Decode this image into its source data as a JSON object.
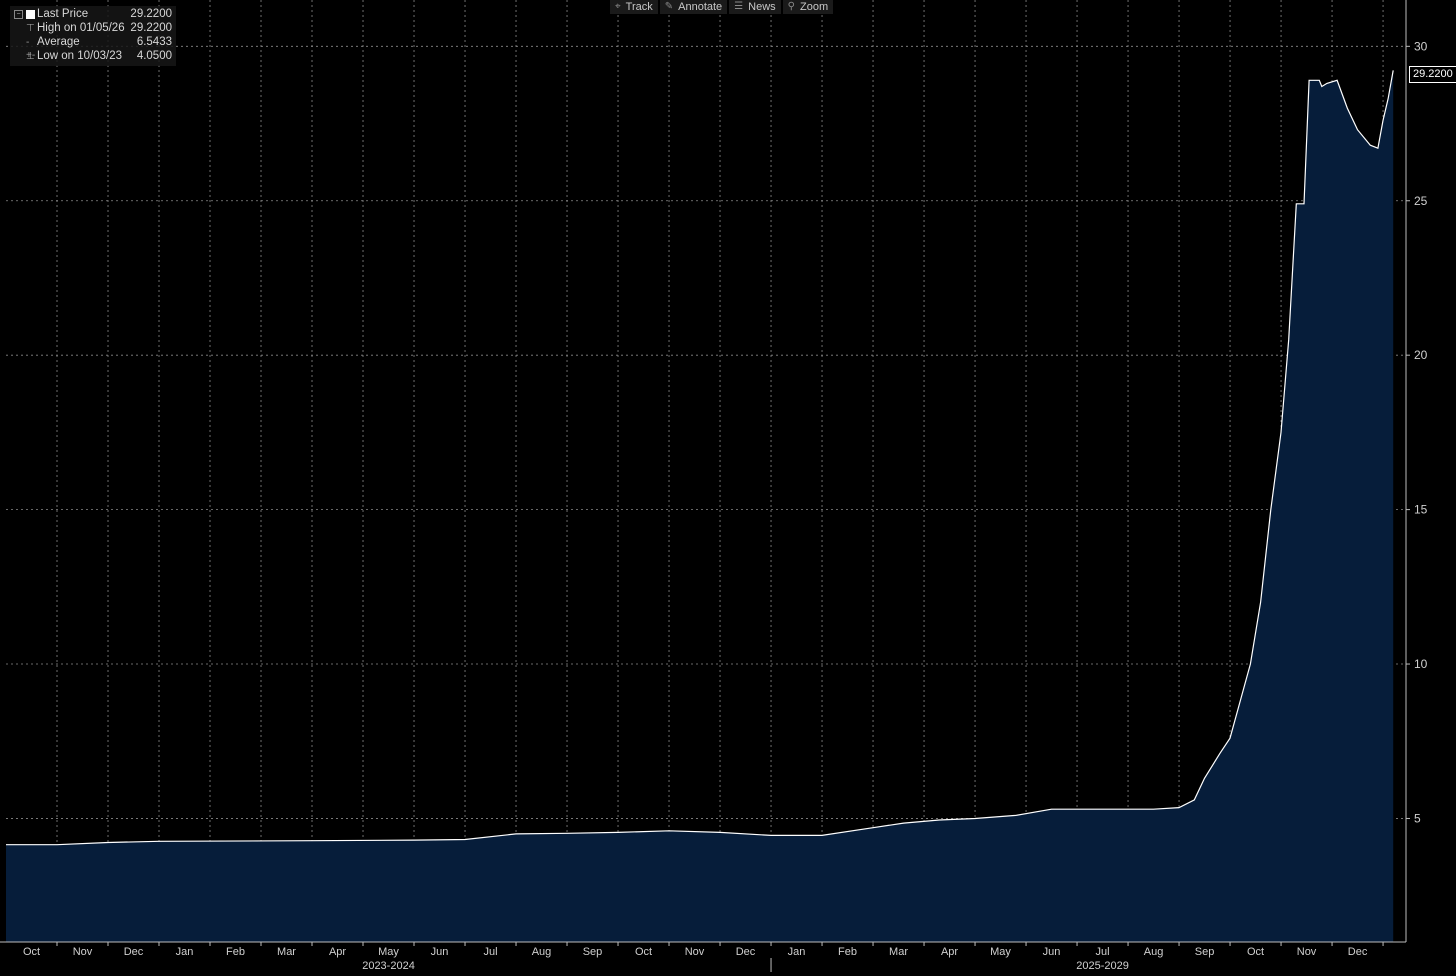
{
  "toolbar": {
    "items": [
      {
        "label": "Track",
        "icon": "crosshair-icon"
      },
      {
        "label": "Annotate",
        "icon": "pencil-icon"
      },
      {
        "label": "News",
        "icon": "news-icon"
      },
      {
        "label": "Zoom",
        "icon": "magnifier-icon"
      }
    ]
  },
  "legend": {
    "last_label": "Last Price",
    "last_value": "29.2200",
    "high_label": "High on 01/05/26",
    "high_value": "29.2200",
    "avg_label": "Average",
    "avg_value": "6.5433",
    "low_label": "Low on 10/03/23",
    "low_value": "4.0500"
  },
  "colors": {
    "background": "#000000",
    "line": "#ffffff",
    "area": "#061d3a",
    "grid": "#8a8a8a"
  },
  "chart_data": {
    "type": "area",
    "title": "",
    "xlabel": "",
    "ylabel": "",
    "ylim": [
      1.0,
      31.5
    ],
    "last_value_badge": "29.2200",
    "yticks": [
      5,
      10,
      15,
      20,
      25,
      30
    ],
    "ytick_labels": [
      "5",
      "10",
      "15",
      "20",
      "25",
      "30"
    ],
    "xticks": [
      {
        "label": "Oct",
        "t": 0.5
      },
      {
        "label": "Nov",
        "t": 1.5
      },
      {
        "label": "Dec",
        "t": 2.5
      },
      {
        "label": "Jan",
        "t": 3.5
      },
      {
        "label": "Feb",
        "t": 4.5
      },
      {
        "label": "Mar",
        "t": 5.5
      },
      {
        "label": "Apr",
        "t": 6.5
      },
      {
        "label": "May",
        "t": 7.5
      },
      {
        "label": "Jun",
        "t": 8.5
      },
      {
        "label": "Jul",
        "t": 9.5
      },
      {
        "label": "Aug",
        "t": 10.5
      },
      {
        "label": "Sep",
        "t": 11.5
      },
      {
        "label": "Oct",
        "t": 12.5
      },
      {
        "label": "Nov",
        "t": 13.5
      },
      {
        "label": "Dec",
        "t": 14.5
      },
      {
        "label": "Jan",
        "t": 15.5
      },
      {
        "label": "Feb",
        "t": 16.5
      },
      {
        "label": "Mar",
        "t": 17.5
      },
      {
        "label": "Apr",
        "t": 18.5
      },
      {
        "label": "May",
        "t": 19.5
      },
      {
        "label": "Jun",
        "t": 20.5
      },
      {
        "label": "Jul",
        "t": 21.5
      },
      {
        "label": "Aug",
        "t": 22.5
      },
      {
        "label": "Sep",
        "t": 23.5
      },
      {
        "label": "Oct",
        "t": 24.5
      },
      {
        "label": "Nov",
        "t": 25.5
      },
      {
        "label": "Dec",
        "t": 26.5
      }
    ],
    "year_labels": [
      {
        "label": "2023-2024",
        "t": 7.5
      },
      {
        "label": "2025-2029",
        "t": 21.5
      }
    ],
    "year_divider_t": 15.0,
    "series": [
      {
        "points": [
          [
            0.0,
            4.15
          ],
          [
            1.0,
            4.15
          ],
          [
            2.0,
            4.22
          ],
          [
            3.0,
            4.26
          ],
          [
            6.0,
            4.28
          ],
          [
            8.0,
            4.3
          ],
          [
            9.0,
            4.32
          ],
          [
            10.0,
            4.5
          ],
          [
            11.0,
            4.52
          ],
          [
            12.0,
            4.55
          ],
          [
            13.0,
            4.6
          ],
          [
            14.0,
            4.55
          ],
          [
            15.0,
            4.45
          ],
          [
            16.0,
            4.45
          ],
          [
            17.0,
            4.7
          ],
          [
            17.6,
            4.85
          ],
          [
            18.3,
            4.95
          ],
          [
            19.0,
            5.0
          ],
          [
            19.8,
            5.1
          ],
          [
            20.5,
            5.3
          ],
          [
            21.5,
            5.3
          ],
          [
            22.5,
            5.3
          ],
          [
            23.0,
            5.35
          ],
          [
            23.3,
            5.6
          ],
          [
            23.5,
            6.3
          ],
          [
            23.8,
            7.1
          ],
          [
            24.0,
            7.6
          ],
          [
            24.2,
            8.8
          ],
          [
            24.4,
            10.0
          ],
          [
            24.6,
            12.0
          ],
          [
            24.8,
            15.0
          ],
          [
            25.0,
            17.5
          ],
          [
            25.15,
            20.5
          ],
          [
            25.3,
            24.9
          ],
          [
            25.45,
            24.9
          ],
          [
            25.55,
            28.9
          ],
          [
            25.75,
            28.9
          ],
          [
            25.8,
            28.7
          ],
          [
            25.9,
            28.8
          ],
          [
            26.1,
            28.9
          ],
          [
            26.3,
            28.0
          ],
          [
            26.5,
            27.3
          ],
          [
            26.75,
            26.8
          ],
          [
            26.9,
            26.7
          ],
          [
            27.0,
            27.6
          ],
          [
            27.1,
            28.3
          ],
          [
            27.2,
            29.22
          ]
        ]
      }
    ]
  }
}
